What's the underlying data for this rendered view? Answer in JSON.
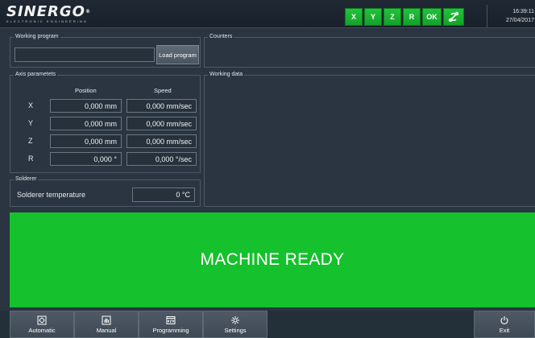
{
  "header": {
    "logo": "SINERGO",
    "logo_tagline": "ELECTRONIC ENGINEERING",
    "axis_buttons": [
      {
        "label": "X"
      },
      {
        "label": "Y"
      },
      {
        "label": "Z"
      },
      {
        "label": "R"
      },
      {
        "label": "OK"
      }
    ],
    "time": "16:39:11",
    "date": "27/04/2017"
  },
  "working_program": {
    "title": "Working program",
    "path_value": "",
    "load_button": "Load program"
  },
  "counters": {
    "title": "Counters"
  },
  "working_data": {
    "title": "Working data"
  },
  "axis_parameters": {
    "title": "Axis parametets",
    "position_header": "Position",
    "speed_header": "Speed",
    "rows": [
      {
        "axis": "X",
        "position": "0,000 mm",
        "speed": "0,000 mm/sec"
      },
      {
        "axis": "Y",
        "position": "0,000 mm",
        "speed": "0,000 mm/sec"
      },
      {
        "axis": "Z",
        "position": "0,000 mm",
        "speed": "0,000 mm/sec"
      },
      {
        "axis": "R",
        "position": "0,000 °",
        "speed": "0,000 °/sec"
      }
    ]
  },
  "solderer": {
    "title": "Solderer",
    "temperature_label": "Solderer temperature",
    "temperature_value": "0 °C"
  },
  "status": {
    "message": "MACHINE READY",
    "color": "#15c12c"
  },
  "nav": {
    "items": [
      {
        "label": "Automatic",
        "icon": "automatic-icon"
      },
      {
        "label": "Manual",
        "icon": "manual-icon"
      },
      {
        "label": "Programming",
        "icon": "programming-icon"
      },
      {
        "label": "Settings",
        "icon": "gear-icon"
      },
      {
        "label": "Exit",
        "icon": "power-icon"
      }
    ]
  }
}
